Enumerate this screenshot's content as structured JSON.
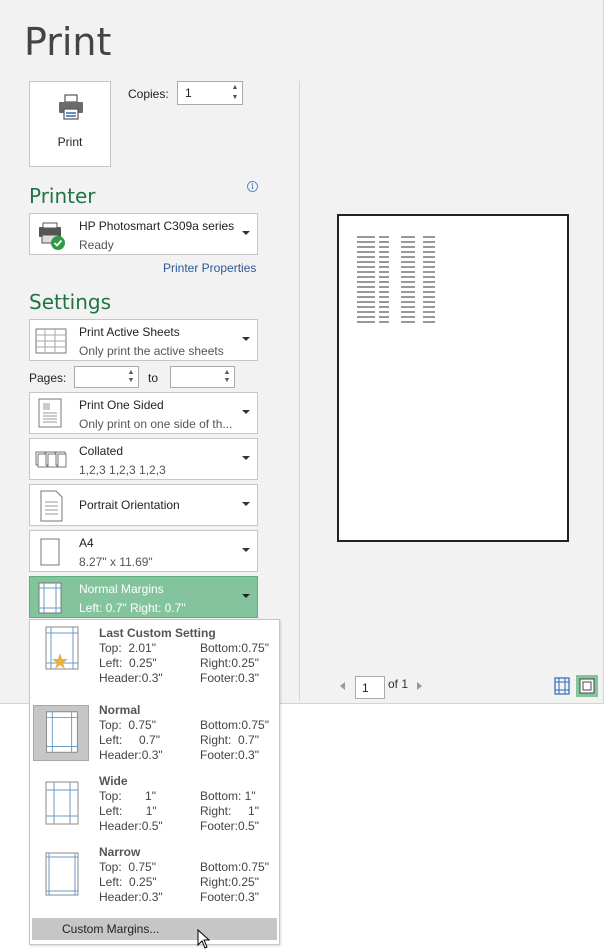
{
  "title": "Print",
  "print_button": {
    "label": "Print"
  },
  "copies": {
    "label": "Copies:",
    "value": "1"
  },
  "printer": {
    "heading": "Printer",
    "name": "HP Photosmart C309a series",
    "status": "Ready",
    "properties_link": "Printer Properties"
  },
  "settings": {
    "heading": "Settings",
    "sheets": {
      "l1": "Print Active Sheets",
      "l2": "Only print the active sheets"
    },
    "pages": {
      "label": "Pages:",
      "to": "to"
    },
    "sided": {
      "l1": "Print One Sided",
      "l2": "Only print on one side of th..."
    },
    "collated": {
      "l1": "Collated",
      "l2": "1,2,3    1,2,3    1,2,3"
    },
    "orientation": {
      "label": "Portrait Orientation"
    },
    "paper": {
      "l1": "A4",
      "l2": "8.27\" x 11.69\""
    },
    "margins": {
      "l1": "Normal Margins",
      "l2": "Left:  0.7\"    Right:  0.7\""
    }
  },
  "margins_menu": {
    "items": [
      {
        "name": "Last Custom Setting",
        "c1": "Top:  2.01\"\nLeft:  0.25\"\nHeader:0.3\"",
        "c2": "Bottom:0.75\"\nRight:0.25\"\nFooter:0.3\""
      },
      {
        "name": "Normal",
        "c1": "Top:  0.75\"\nLeft:     0.7\"\nHeader:0.3\"",
        "c2": "Bottom:0.75\"\nRight:  0.7\"\nFooter:0.3\""
      },
      {
        "name": "Wide",
        "c1": "Top:       1\"\nLeft:       1\"\nHeader:0.5\"",
        "c2": "Bottom: 1\"\nRight:     1\"\nFooter:0.5\""
      },
      {
        "name": "Narrow",
        "c1": "Top:  0.75\"\nLeft:  0.25\"\nHeader:0.3\"",
        "c2": "Bottom:0.75\"\nRight:0.25\"\nFooter:0.3\""
      }
    ],
    "custom": "Custom Margins..."
  },
  "preview_nav": {
    "page": "1",
    "of": "of 1"
  },
  "colors": {
    "accent": "#217346",
    "selected": "#84c49d",
    "link": "#2b579a"
  },
  "icons": [
    "printer-icon",
    "info-icon",
    "sheets-icon",
    "one-sided-icon",
    "collated-icon",
    "portrait-icon",
    "paper-icon",
    "margins-icon",
    "star-icon",
    "show-margins-icon",
    "zoom-page-icon",
    "cursor-icon"
  ]
}
